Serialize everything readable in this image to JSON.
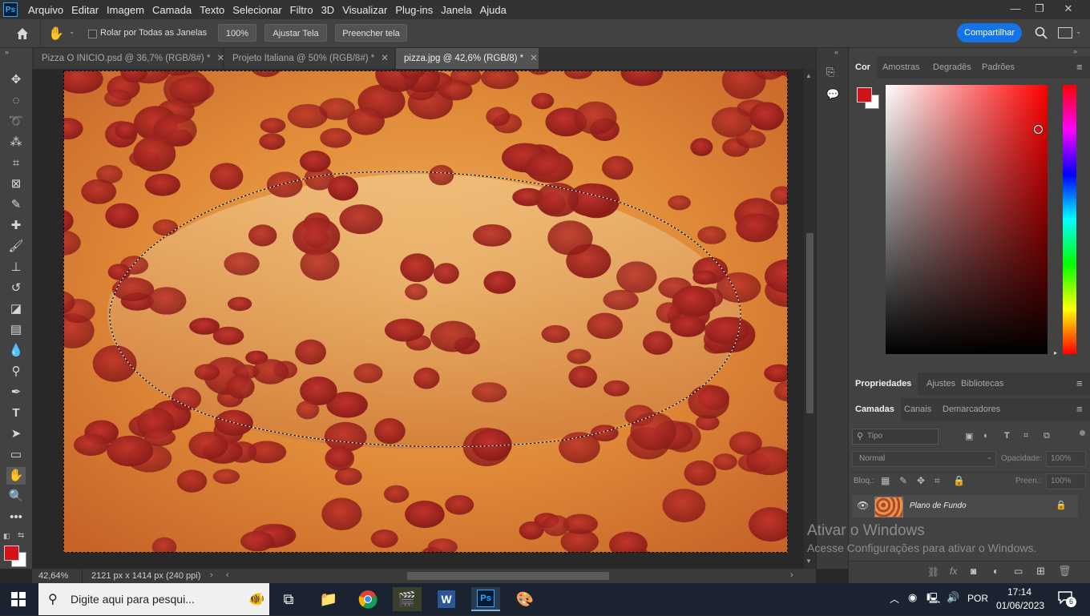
{
  "app": {
    "logo": "Ps"
  },
  "menu": [
    "Arquivo",
    "Editar",
    "Imagem",
    "Camada",
    "Texto",
    "Selecionar",
    "Filtro",
    "3D",
    "Visualizar",
    "Plug-ins",
    "Janela",
    "Ajuda"
  ],
  "window_controls": {
    "minimize": "—",
    "restore": "❐",
    "close": "✕"
  },
  "options_bar": {
    "scroll_all_label": "Rolar por Todas as Janelas",
    "zoom_btn": "100%",
    "fit_btn": "Ajustar Tela",
    "fill_btn": "Preencher tela",
    "share_btn": "Compartilhar"
  },
  "tabs": [
    {
      "label": "Pizza O INICIO.psd @ 36,7% (RGB/8#) *"
    },
    {
      "label": "Projeto Italiana @ 50% (RGB/8#) *"
    },
    {
      "label": "pizza.jpg @ 42,6% (RGB/8) *"
    }
  ],
  "status": {
    "zoom": "42,64%",
    "doc_info": "2121 px x 1414 px (240 ppi)"
  },
  "color_panel": {
    "tabs": [
      "Cor",
      "Amostras",
      "Degradês",
      "Padrões"
    ],
    "foreground": "#d4121a",
    "background": "#ffffff",
    "hue": "#ff0000"
  },
  "properties_panel": {
    "tabs": [
      "Propriedades",
      "Ajustes",
      "Bibliotecas"
    ]
  },
  "layers_panel": {
    "tabs": [
      "Camadas",
      "Canais",
      "Demarcadores"
    ],
    "filter_placeholder": "Tipo",
    "blend_mode": "Normal",
    "opacity_label": "Opacidade:",
    "opacity_value": "100%",
    "lock_label": "Bloq.:",
    "fill_label": "Preen.:",
    "fill_value": "100%",
    "layers": [
      {
        "name": "Plano de Fundo"
      }
    ]
  },
  "watermark": {
    "title": "Ativar o Windows",
    "subtitle": "Acesse Configurações para ativar o Windows."
  },
  "taskbar": {
    "search_placeholder": "Digite aqui para pesqui...",
    "lang": "POR",
    "time": "17:14",
    "date": "01/06/2023",
    "notif_count": "6"
  }
}
